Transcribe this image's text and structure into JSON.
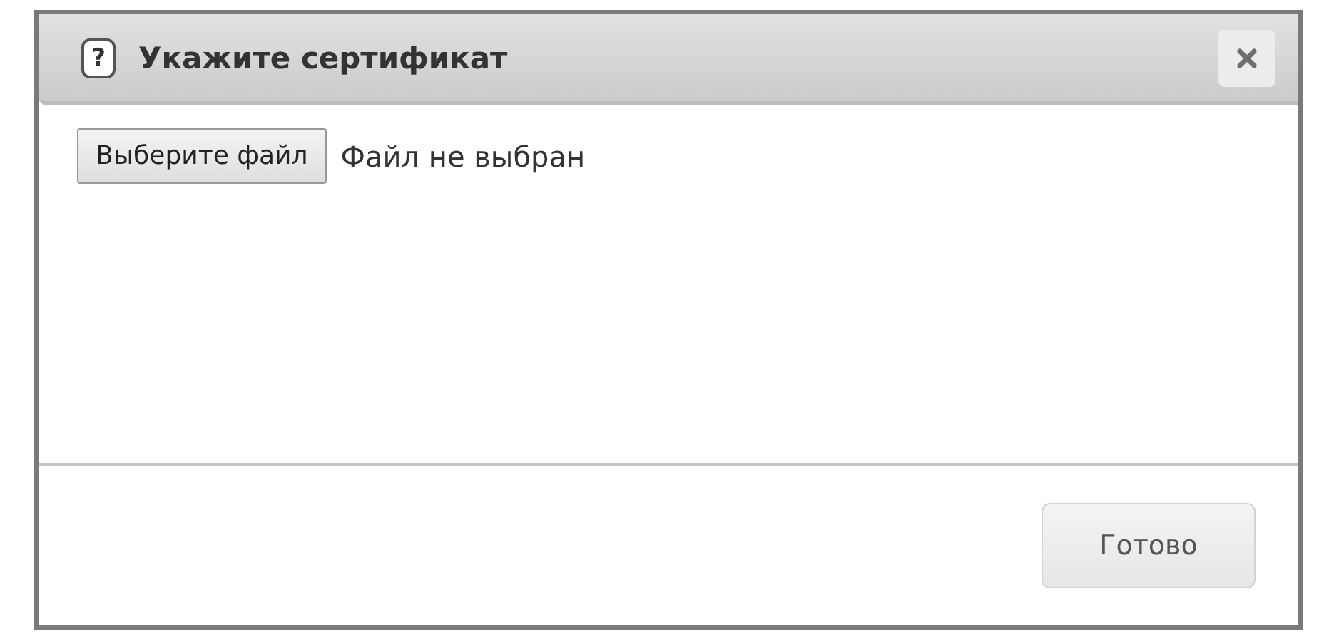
{
  "dialog": {
    "help_glyph": "?",
    "title": "Укажите сертификат"
  },
  "file_input": {
    "button": "Выберите файл",
    "status": "Файл не выбран"
  },
  "buttons": [
    "Готово"
  ]
}
